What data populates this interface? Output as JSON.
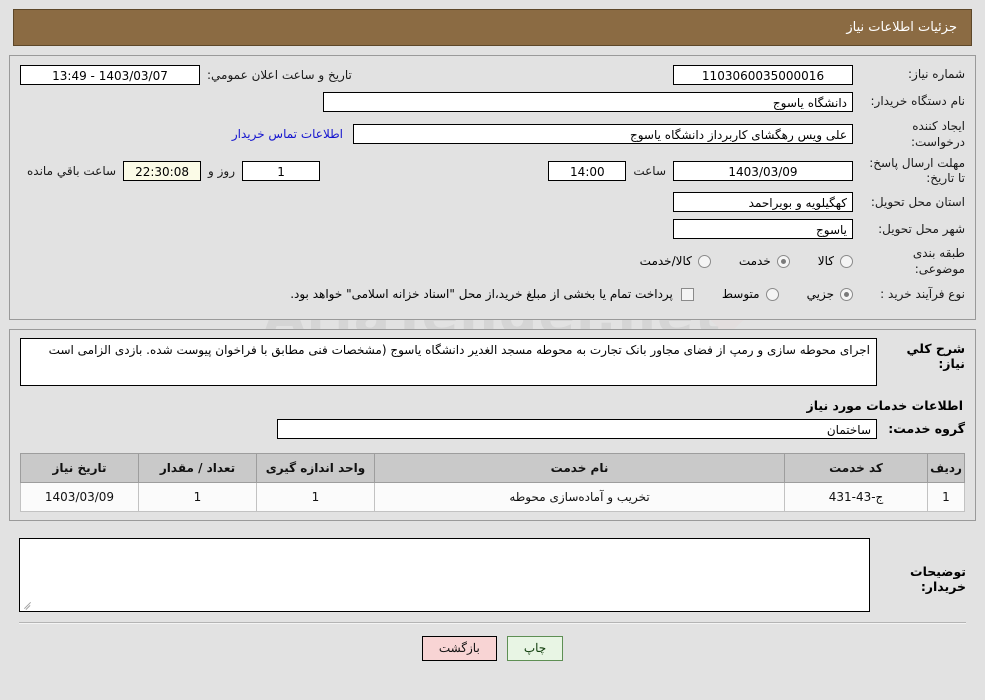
{
  "header": {
    "title": "جزئیات اطلاعات نیاز",
    "bar_color": "#8b6b43"
  },
  "summary": {
    "need_number_label": "شماره نیاز:",
    "need_number_value": "1103060035000016",
    "announce_label": "تاریخ و ساعت اعلان عمومي:",
    "announce_value": "1403/03/07 - 13:49",
    "buyer_org_label": "نام دستگاه خریدار:",
    "buyer_org_value": "دانشگاه یاسوج",
    "creator_label": "ایجاد کننده درخواست:",
    "creator_value": "علی ویس رهگشای کاربرداز دانشگاه یاسوج",
    "contact_link": "اطلاعات تماس خریدار",
    "deadline_label": "مهلت ارسال پاسخ: تا تاریخ:",
    "deadline_date": "1403/03/09",
    "deadline_time_label": "ساعت",
    "deadline_time": "14:00",
    "remaining_days": "1",
    "remaining_days_label": "روز و",
    "remaining_clock": "22:30:08",
    "remaining_clock_label": "ساعت باقي مانده",
    "province_label": "استان محل تحویل:",
    "province_value": "کهگیلویه و بویراحمد",
    "city_label": "شهر محل تحویل:",
    "city_value": "یاسوج",
    "category_label": "طبقه بندی موضوعی:",
    "category_options": [
      {
        "label": "کالا",
        "selected": false
      },
      {
        "label": "خدمت",
        "selected": true
      },
      {
        "label": "کالا/خدمت",
        "selected": false
      }
    ],
    "process_label": "نوع فرآیند خرید :",
    "process_options": [
      {
        "label": "جزیي",
        "selected": true
      },
      {
        "label": "متوسط",
        "selected": false
      }
    ],
    "payment_checkbox_checked": false,
    "payment_note": "پرداخت تمام یا بخشی از مبلغ خرید،از محل \"اسناد خزانه اسلامی\" خواهد بود."
  },
  "need_desc": {
    "label": "شرح كلي نياز:",
    "text": "اجرای محوطه سازی و رمپ از فضای مجاور بانک تجارت به محوطه مسجد الغدیر دانشگاه یاسوج (مشخصات فنی مطابق با فراخوان پیوست شده. بازدی الزامی است"
  },
  "services": {
    "section_title": "اطلاعات خدمات مورد نیاز",
    "group_label": "گروه خدمت:",
    "group_value": "ساختمان",
    "columns": [
      "ردیف",
      "کد خدمت",
      "نام خدمت",
      "واحد اندازه گیری",
      "تعداد / مقدار",
      "تاریخ نیاز"
    ],
    "rows": [
      {
        "index": "1",
        "code": "ج-43-431",
        "name": "تخریب و آماده‌سازی محوطه",
        "unit": "1",
        "qty": "1",
        "date": "1403/03/09"
      }
    ]
  },
  "buyer_notes": {
    "label": "توضیحات خریدار:",
    "value": ""
  },
  "footer": {
    "print_label": "چاپ",
    "back_label": "بازگشت"
  },
  "watermark": {
    "text": "AriaTender.net"
  }
}
